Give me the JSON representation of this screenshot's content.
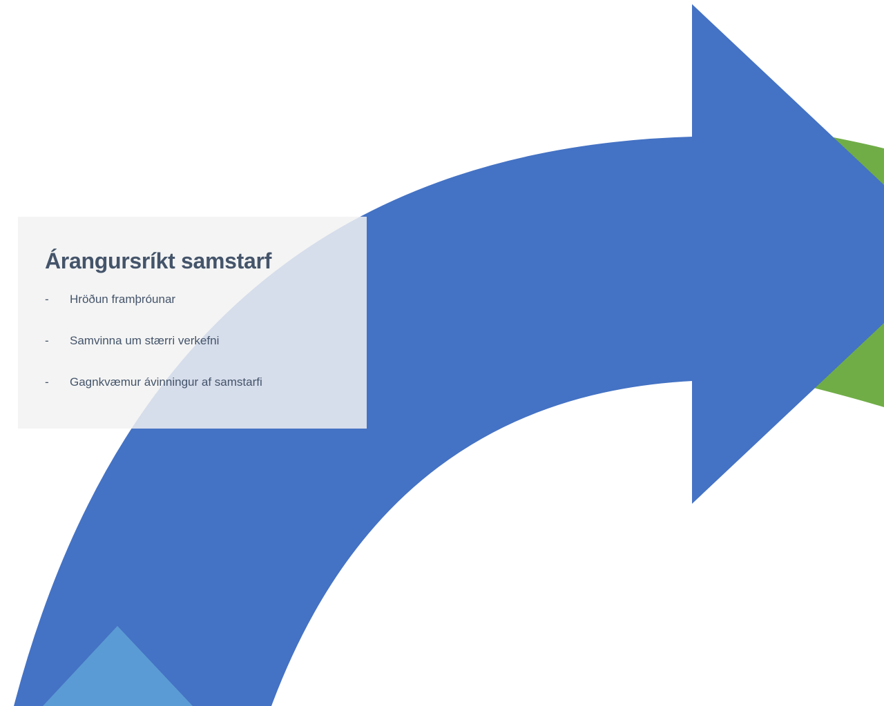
{
  "title": "Árangursríkt samstarf",
  "bullet_marker": "-",
  "items": [
    "Hröðun framþróunar",
    "Samvinna um stærri verkefni",
    "Gagnkvæmur ávinningur af samstarfi"
  ],
  "colors": {
    "primary_arrow": "#4472c4",
    "secondary_arrow": "#70ad47",
    "small_arrow": "#5b9bd5",
    "text": "#44546a",
    "card_background": "#f2f2f2"
  }
}
